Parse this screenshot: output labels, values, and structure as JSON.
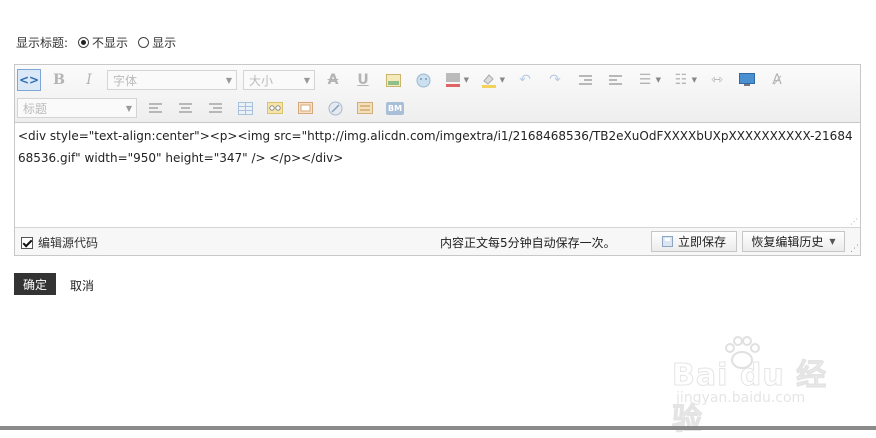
{
  "title_option": {
    "label": "显示标题:",
    "options": [
      {
        "label": "不显示",
        "selected": true
      },
      {
        "label": "显示",
        "selected": false
      }
    ]
  },
  "toolbar": {
    "source_icon": "code-icon",
    "font_select_placeholder": "字体",
    "size_select_placeholder": "大小",
    "heading_select_placeholder": "标题",
    "bold_label": "B",
    "italic_label": "I",
    "icons_row1": [
      "bold-icon",
      "italic-icon",
      "strikethrough-icon",
      "underline-icon",
      "image-icon",
      "emoticon-icon",
      "font-color-icon",
      "highlight-color-icon",
      "undo-icon",
      "redo-icon",
      "indent-icon",
      "outdent-icon",
      "bullet-list-icon",
      "numbered-list-icon",
      "horizontal-rule-icon",
      "video-icon",
      "clear-format-icon"
    ],
    "icons_row2": [
      "align-left-icon",
      "align-center-icon",
      "align-right-icon",
      "table-icon",
      "glasses-icon",
      "frame-icon",
      "link-icon",
      "code-block-icon",
      "bm-icon"
    ],
    "bm_text": "BM"
  },
  "editor": {
    "source_code": "<div style=\"text-align:center\"><p><img src=\"http://img.alicdn.com/imgextra/i1/2168468536/TB2eXuOdFXXXXbUXpXXXXXXXXXX-2168468536.gif\"  width=\"950\" height=\"347\" /> </p></div>"
  },
  "status_bar": {
    "edit_source_label": "编辑源代码",
    "edit_source_checked": true,
    "autosave_text": "内容正文每5分钟自动保存一次。",
    "save_now_label": "立即保存",
    "restore_history_label": "恢复编辑历史"
  },
  "actions": {
    "confirm_label": "确定",
    "cancel_label": "取消"
  },
  "watermark": {
    "brand": "Bai du 经验",
    "url": "jingyan.baidu.com"
  }
}
